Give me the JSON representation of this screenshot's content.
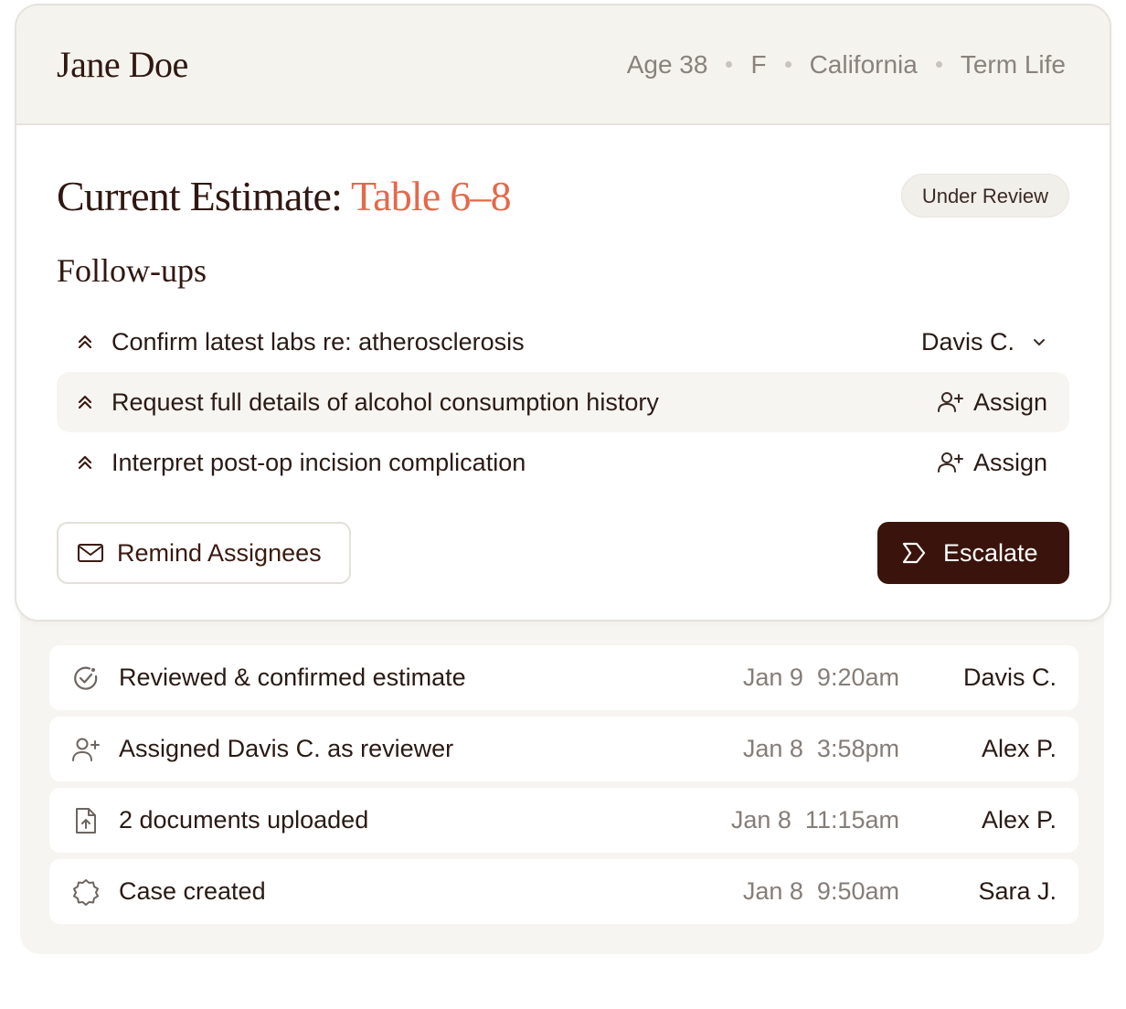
{
  "header": {
    "name": "Jane Doe",
    "meta": [
      "Age 38",
      "F",
      "California",
      "Term Life"
    ]
  },
  "estimate": {
    "label": "Current Estimate:",
    "value": "Table 6–8",
    "status": "Under Review"
  },
  "followups": {
    "title": "Follow-ups",
    "items": [
      {
        "text": "Confirm latest labs re: atherosclerosis",
        "assignee": "Davis C.",
        "priority_icon": "chevrons-up-icon"
      },
      {
        "text": "Request full details of alcohol consumption history",
        "assignee": "Assign",
        "priority_icon": "chevrons-up-icon"
      },
      {
        "text": "Interpret post-op incision complication",
        "assignee": "Assign",
        "priority_icon": "chevrons-up-icon"
      }
    ]
  },
  "actions": {
    "remind_label": "Remind Assignees",
    "escalate_label": "Escalate"
  },
  "activity": [
    {
      "icon": "check-circle-icon",
      "text": "Reviewed & confirmed estimate",
      "time": "Jan 9  9:20am",
      "user": "Davis C."
    },
    {
      "icon": "user-plus-icon",
      "text": "Assigned Davis C. as reviewer",
      "time": "Jan 8  3:58pm",
      "user": "Alex P."
    },
    {
      "icon": "file-upload-icon",
      "text": "2 documents uploaded",
      "time": "Jan 8  11:15am",
      "user": "Alex P."
    },
    {
      "icon": "badge-icon",
      "text": "Case created",
      "time": "Jan 8  9:50am",
      "user": "Sara J."
    }
  ],
  "colors": {
    "accent": "#e4694a",
    "dark_brown": "#3a140c",
    "header_bg": "#f5f3ee",
    "panel_bg": "#f7f5f1"
  }
}
